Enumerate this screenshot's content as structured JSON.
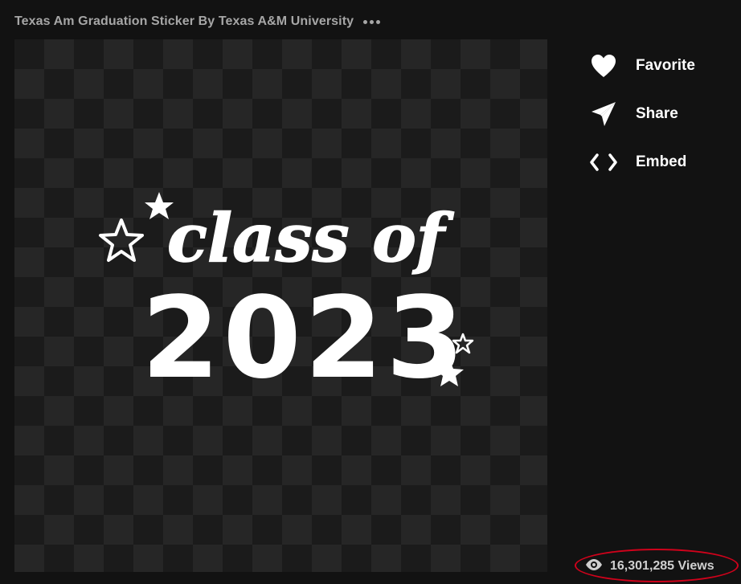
{
  "header": {
    "title": "Texas Am Graduation Sticker By Texas A&M University"
  },
  "sticker": {
    "line1": "class of",
    "line2": "2023"
  },
  "actions": [
    {
      "label": "Favorite",
      "icon": "heart-icon"
    },
    {
      "label": "Share",
      "icon": "paper-plane-icon"
    },
    {
      "label": "Embed",
      "icon": "code-brackets-icon"
    }
  ],
  "stats": {
    "views": "16,301,285 Views",
    "icon": "eye-icon"
  },
  "colors": {
    "background": "#121212",
    "checker_dark": "#1b1b1b",
    "checker_light": "#262626",
    "highlight": "#d0021b"
  }
}
